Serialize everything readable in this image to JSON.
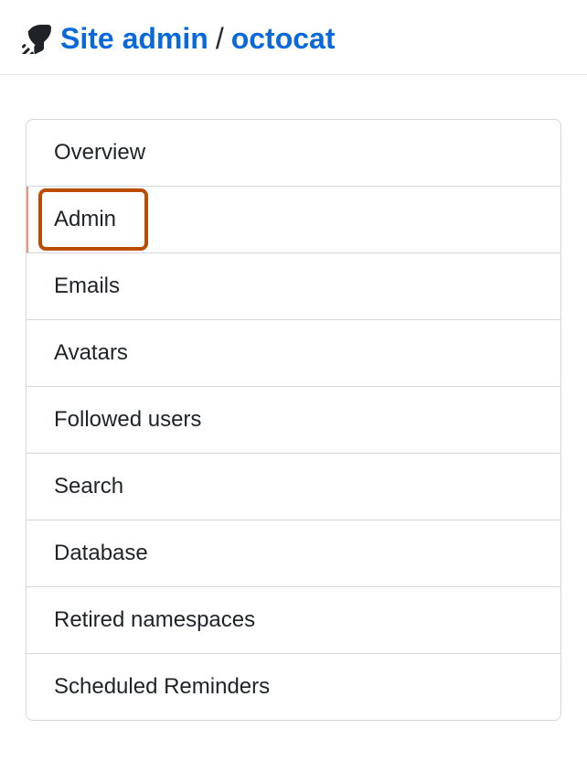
{
  "header": {
    "site_admin_label": "Site admin",
    "separator": "/",
    "username": "octocat"
  },
  "nav": {
    "items": [
      {
        "label": "Overview"
      },
      {
        "label": "Admin"
      },
      {
        "label": "Emails"
      },
      {
        "label": "Avatars"
      },
      {
        "label": "Followed users"
      },
      {
        "label": "Search"
      },
      {
        "label": "Database"
      },
      {
        "label": "Retired namespaces"
      },
      {
        "label": "Scheduled Reminders"
      }
    ]
  }
}
